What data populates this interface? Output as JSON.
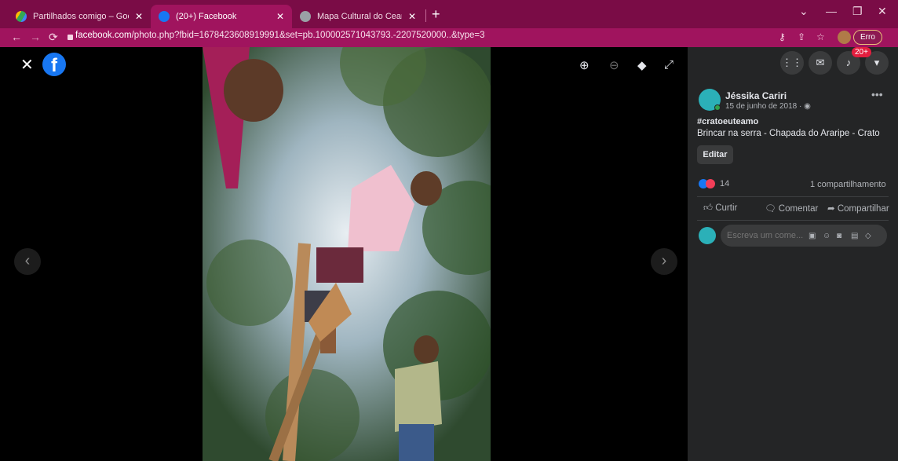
{
  "tabs": [
    {
      "label": "Partilhados comigo – Google Dri",
      "icon": "google-drive-icon",
      "close": "✕"
    },
    {
      "label": "(20+) Facebook",
      "icon": "facebook-icon",
      "close": "✕"
    },
    {
      "label": "Mapa Cultural do Ceará -",
      "icon": "map-icon",
      "close": "✕"
    }
  ],
  "browser": {
    "url_domain": "facebook.com",
    "url_path": "/photo.php?fbid=1678423608919991&set=pb.100002571043793.-2207520000..&type=3",
    "profile_button": "Erro"
  },
  "viewer": {
    "tools": [
      "zoom-in-icon",
      "zoom-out-icon",
      "tag-icon",
      "fullscreen-icon"
    ]
  },
  "post": {
    "author": "Jéssika Cariri",
    "date": "15 de junho de 2018 · ",
    "hashtag": "#cratoeuteamo",
    "caption": "Brincar na serra - Chapada do Araripe - Crato",
    "edit_label": "Editar",
    "reaction_count": "14",
    "shares": "1 compartilhamento",
    "actions": {
      "like": "Curtir",
      "comment": "Comentar",
      "share": "Compartilhar"
    },
    "comment_placeholder": "Escreva um come..."
  },
  "topbar": {
    "notification_badge": "20+"
  },
  "colors": {
    "chrome_frame": "#7a0c46",
    "toolbar": "#a0145e",
    "fb_blue": "#1877f2",
    "panel_bg": "#242526"
  }
}
